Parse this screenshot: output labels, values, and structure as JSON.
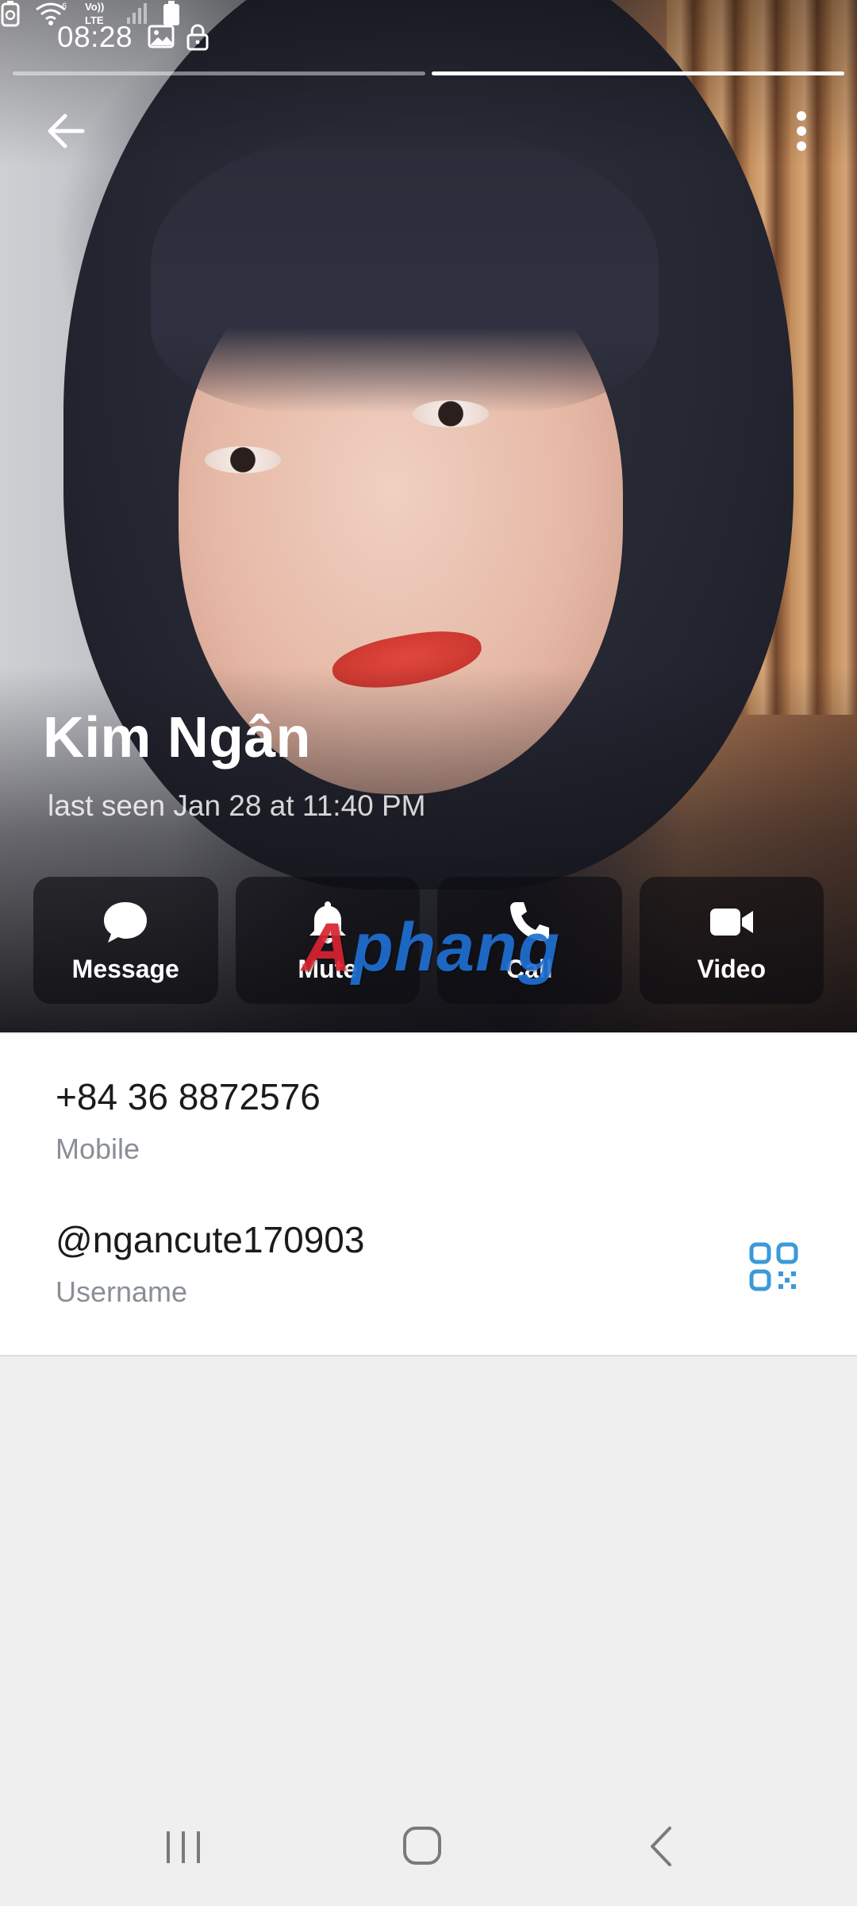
{
  "status_bar": {
    "time": "08:28"
  },
  "profile": {
    "name": "Kim Ngân",
    "last_seen": "last seen Jan 28 at 11:40 PM"
  },
  "actions": [
    {
      "label": "Message",
      "icon": "message-bubble-icon"
    },
    {
      "label": "Mute",
      "icon": "bell-icon"
    },
    {
      "label": "Call",
      "icon": "phone-icon"
    },
    {
      "label": "Video",
      "icon": "video-camera-icon"
    }
  ],
  "watermark": {
    "first": "A",
    "rest": "phang"
  },
  "info": {
    "phone": {
      "value": "+84 36 8872576",
      "label": "Mobile"
    },
    "username": {
      "value": "@ngancute170903",
      "label": "Username"
    }
  },
  "colors": {
    "accent": "#3a9ad9",
    "card": "#ffffff",
    "page_bg": "#efefef"
  }
}
